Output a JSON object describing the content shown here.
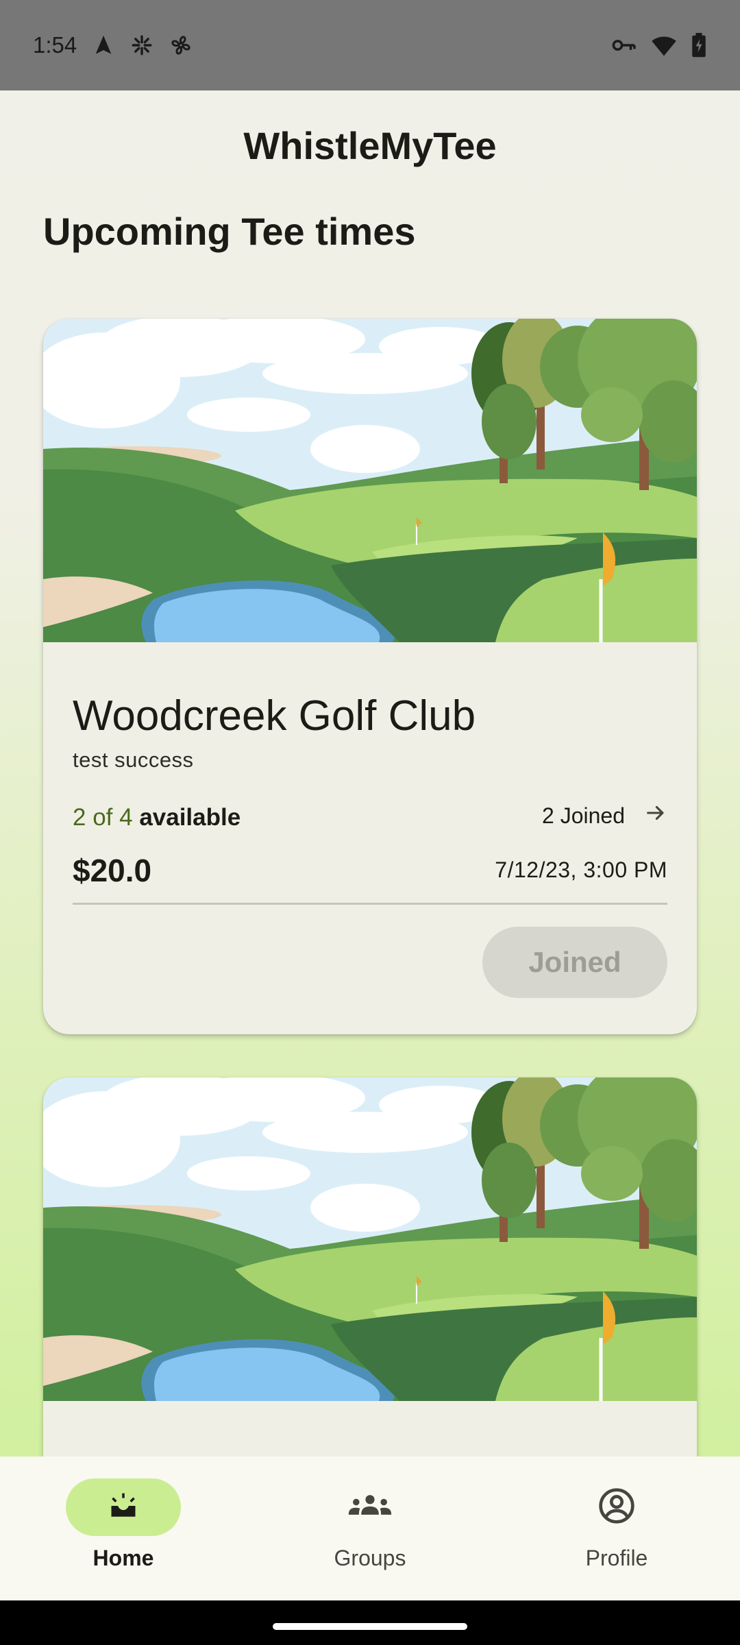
{
  "status_bar": {
    "time": "1:54",
    "left_icons": [
      "navigation-icon",
      "asterisk-icon",
      "fan-icon"
    ],
    "right_icons": [
      "vpn-key-icon",
      "wifi-icon",
      "battery-charging-icon"
    ]
  },
  "app": {
    "title": "WhistleMyTee"
  },
  "section": {
    "title": "Upcoming Tee times"
  },
  "cards": [
    {
      "image": "golf-course-illustration",
      "course_name": "Woodcreek Golf Club",
      "description": "test success",
      "available_count": "2 of 4",
      "available_label": "available",
      "joined_count": "2 Joined",
      "price": "$20.0",
      "datetime": "7/12/23, 3:00 PM",
      "action_label": "Joined"
    },
    {
      "image": "golf-course-illustration"
    }
  ],
  "bottom_nav": {
    "items": [
      {
        "label": "Home",
        "icon": "home-sunrise-icon",
        "active": true
      },
      {
        "label": "Groups",
        "icon": "groups-icon",
        "active": false
      },
      {
        "label": "Profile",
        "icon": "account-circle-icon",
        "active": false
      }
    ]
  },
  "colors": {
    "accent": "#cbed92",
    "available_green": "#4a6a1c",
    "card_bg": "#f0efe6",
    "status_bar": "#777777"
  }
}
